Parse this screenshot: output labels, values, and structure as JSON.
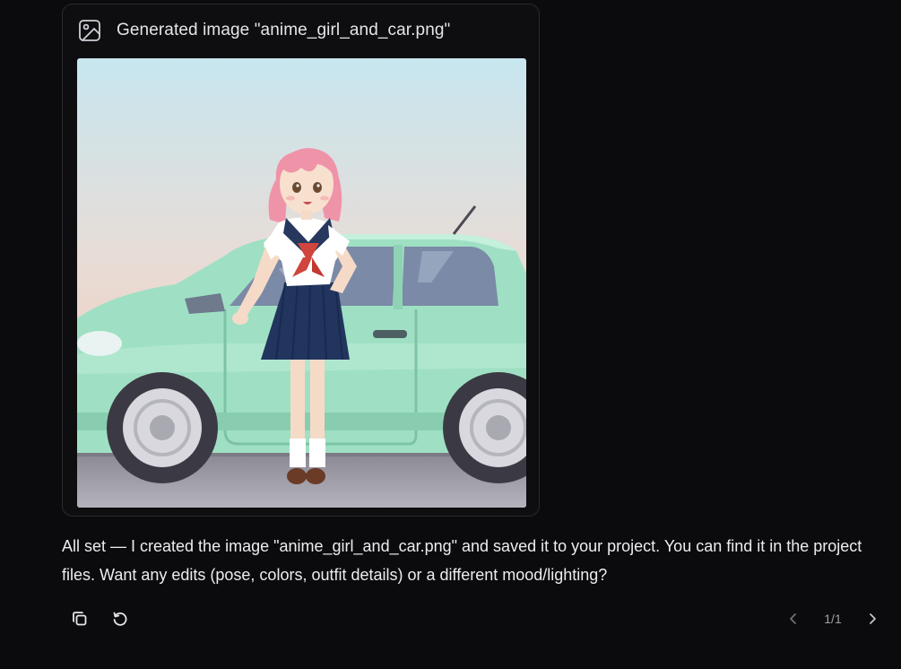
{
  "card": {
    "title": "Generated image \"anime_girl_and_car.png\"",
    "icon": "image-icon",
    "image_alt": "anime_girl_and_car.png"
  },
  "message": {
    "text": "All set — I created the image \"anime_girl_and_car.png\" and saved it to your project. You can find it in the project files. Want any edits (pose, colors, outfit details) or a different mood/lighting?"
  },
  "actions": {
    "copy_icon": "copy-icon",
    "regenerate_icon": "regenerate-icon"
  },
  "pager": {
    "label": "1/1",
    "prev_icon": "chevron-left-icon",
    "next_icon": "chevron-right-icon"
  },
  "colors": {
    "background": "#0b0b0d",
    "card_border": "#2a2a2f",
    "text": "#ececf1",
    "muted": "#a0a0a8"
  }
}
